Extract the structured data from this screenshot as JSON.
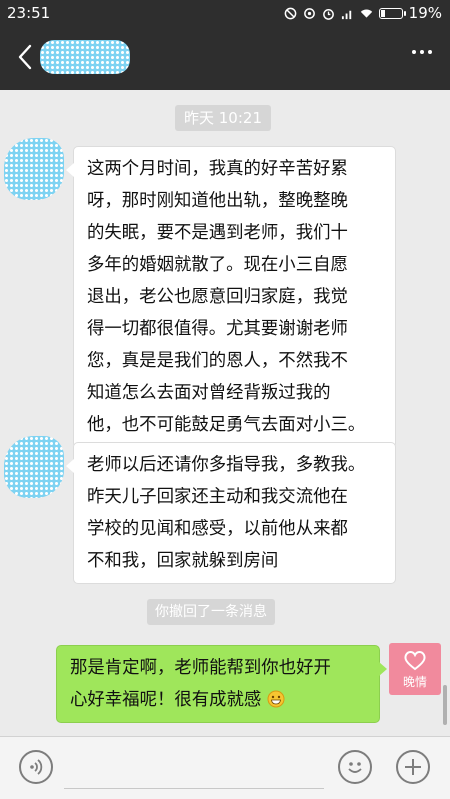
{
  "status_bar": {
    "time": "23:51",
    "battery_percent": "19%",
    "battery_level": 0.19
  },
  "header": {
    "back_icon": "chevron-left-icon",
    "more_icon": "more-dots-icon"
  },
  "conversation": {
    "timestamp": "昨天 10:21",
    "message1_lines": [
      "这两个月时间，我真的好辛苦好累",
      "呀，那时刚知道他出轨，整晚整晚",
      "的失眠，要不是遇到老师，我们十",
      "多年的婚姻就散了。现在小三自愿",
      "退出，老公也愿意回归家庭，我觉",
      "得一切都很值得。尤其要谢谢老师",
      "您，真是是我们的恩人，不然我不",
      "知道怎么去面对曾经背叛过我的",
      "他，也不可能鼓足勇气去面对小三。"
    ],
    "message2_lines": [
      "老师以后还请你多指导我，多教我。",
      "昨天儿子回家还主动和我交流他在",
      "学校的见闻和感受，以前他从来都",
      "不和我，回家就躲到房间"
    ],
    "recall_notice": "你撤回了一条消息",
    "reply_lines": [
      "那是肯定啊，老师能帮到你也好开",
      "心好幸福呢！很有成就感"
    ],
    "my_avatar_label": "晚情"
  },
  "input_bar": {
    "voice_icon": "voice-icon",
    "emoji_icon": "emoji-icon",
    "plus_icon": "plus-icon"
  },
  "colors": {
    "dark_bar": "#2e2e2e",
    "chat_background": "#ebebeb",
    "outgoing_bubble": "#9fe65b",
    "incoming_bubble": "#ffffff",
    "avatar_pink": "#f18a9d"
  }
}
